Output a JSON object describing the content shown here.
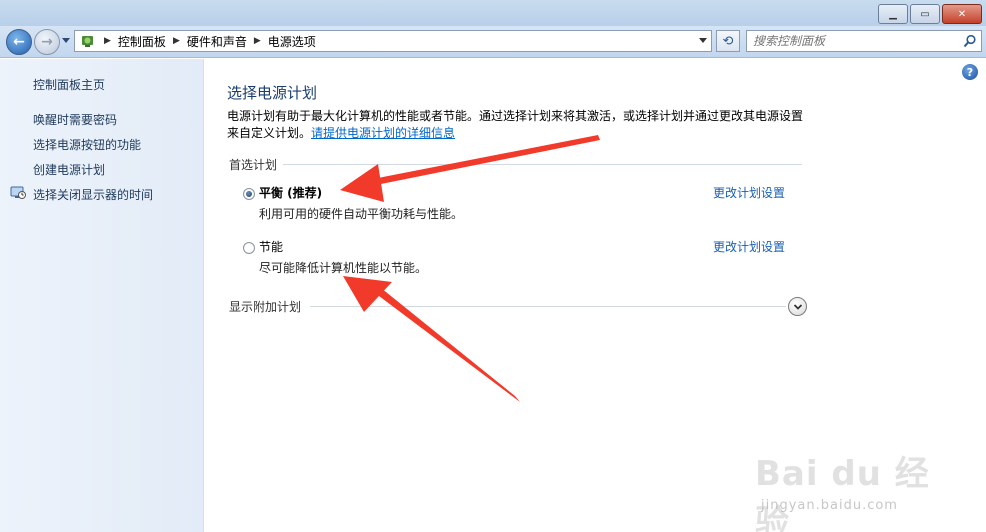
{
  "window": {
    "minimize_icon": "minimize-icon",
    "maximize_icon": "maximize-icon",
    "close_icon": "close-icon"
  },
  "navigation": {
    "breadcrumbs": [
      "控制面板",
      "硬件和声音",
      "电源选项"
    ],
    "search_placeholder": "搜索控制面板"
  },
  "sidebar": {
    "items": [
      {
        "label": "控制面板主页"
      },
      {
        "label": "唤醒时需要密码"
      },
      {
        "label": "选择电源按钮的功能"
      },
      {
        "label": "创建电源计划"
      },
      {
        "label": "选择关闭显示器的时间",
        "icon": "monitor-clock-icon"
      }
    ]
  },
  "main": {
    "title": "选择电源计划",
    "description_line1": "电源计划有助于最大化计算机的性能或者节能。通过选择计划来将其激活，或选择计划并通过更改其电源设置",
    "description_line2_prefix": "来自定义计划。",
    "description_link": "请提供电源计划的详细信息",
    "preferred_group_label": "首选计划",
    "plans": [
      {
        "name": "平衡 (推荐)",
        "description": "利用可用的硬件自动平衡功耗与性能。",
        "selected": true,
        "change_label": "更改计划设置"
      },
      {
        "name": "节能",
        "description": "尽可能降低计算机性能以节能。",
        "selected": false,
        "change_label": "更改计划设置"
      }
    ],
    "more_plans_label": "显示附加计划",
    "help_label": "?"
  },
  "watermark": {
    "brand": "Bai du 经验",
    "url": "jingyan.baidu.com"
  },
  "colors": {
    "link": "#1a5fb4",
    "title": "#1a3e6f",
    "annotation_arrow": "#f23a2a"
  }
}
